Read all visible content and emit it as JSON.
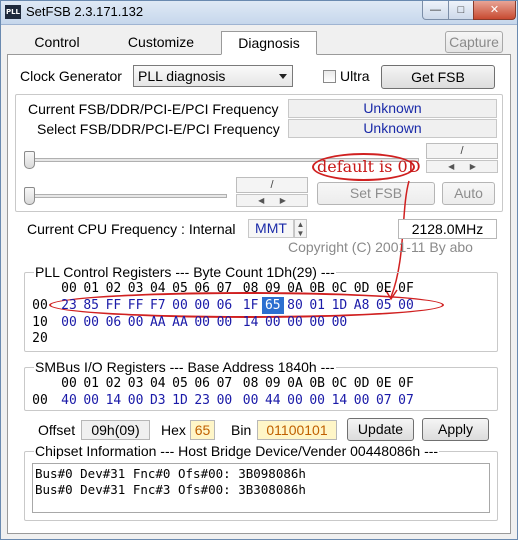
{
  "window": {
    "title": "SetFSB 2.3.171.132",
    "icon_text": "PLL"
  },
  "tabs": [
    {
      "label": "Control"
    },
    {
      "label": "Customize"
    },
    {
      "label": "Diagnosis"
    }
  ],
  "capture_label": "Capture",
  "clock": {
    "label": "Clock Generator",
    "selected": "PLL diagnosis",
    "ultra_label": "Ultra",
    "ultra_checked": false,
    "get_fsb_label": "Get FSB"
  },
  "freq": {
    "current_label": "Current FSB/DDR/PCI-E/PCI Frequency",
    "current_value": "Unknown",
    "select_label": "Select FSB/DDR/PCI-E/PCI Frequency",
    "select_value": "Unknown",
    "set_fsb_label": "Set FSB",
    "auto_label": "Auto"
  },
  "cpu": {
    "label": "Current CPU Frequency : Internal",
    "mode": "MMT",
    "value": "2128.0MHz",
    "copyright": "Copyright (C) 2001-11 By abo"
  },
  "pll": {
    "title": "PLL Control Registers  --- Byte Count 1Dh(29) ---",
    "col_headers": [
      "00",
      "01",
      "02",
      "03",
      "04",
      "05",
      "06",
      "07",
      "08",
      "09",
      "0A",
      "0B",
      "0C",
      "0D",
      "0E",
      "0F"
    ],
    "rows": [
      {
        "label": "00",
        "values": [
          "23",
          "85",
          "FF",
          "FF",
          "F7",
          "00",
          "00",
          "06",
          "1F",
          "65",
          "80",
          "01",
          "1D",
          "A8",
          "05",
          "00"
        ]
      },
      {
        "label": "10",
        "values": [
          "00",
          "00",
          "06",
          "00",
          "AA",
          "AA",
          "00",
          "00",
          "14",
          "00",
          "00",
          "00",
          "00",
          "",
          "",
          ""
        ]
      },
      {
        "label": "20",
        "values": [
          "",
          "",
          "",
          "",
          "",
          "",
          "",
          "",
          "",
          "",
          "",
          "",
          "",
          "",
          "",
          ""
        ]
      }
    ],
    "selected_value": "65"
  },
  "annotation": {
    "text": "default is 0D"
  },
  "smbus": {
    "title": "SMBus I/O Registers  --- Base Address 1840h ---",
    "col_headers": [
      "00",
      "01",
      "02",
      "03",
      "04",
      "05",
      "06",
      "07",
      "08",
      "09",
      "0A",
      "0B",
      "0C",
      "0D",
      "0E",
      "0F"
    ],
    "row": {
      "label": "00",
      "values": [
        "40",
        "00",
        "14",
        "00",
        "D3",
        "1D",
        "23",
        "00",
        "00",
        "44",
        "00",
        "00",
        "14",
        "00",
        "07",
        "07"
      ]
    }
  },
  "offset": {
    "offset_label": "Offset",
    "offset_value": "09h(09)",
    "hex_label": "Hex",
    "hex_value": "65",
    "bin_label": "Bin",
    "bin_value": "01100101",
    "update_label": "Update",
    "apply_label": "Apply"
  },
  "chipset": {
    "title": "Chipset Information  --- Host Bridge Device/Vender 00448086h ---",
    "lines": [
      "Bus#0 Dev#31 Fnc#0 Ofs#00: 3B098086h",
      "Bus#0 Dev#31 Fnc#3 Ofs#00: 3B308086h"
    ]
  },
  "colors": {
    "value_blue": "#1a2aa8",
    "annotation_red": "#c81818",
    "selection_blue": "#2c6fd0",
    "field_yellow": "#fff6c8"
  }
}
